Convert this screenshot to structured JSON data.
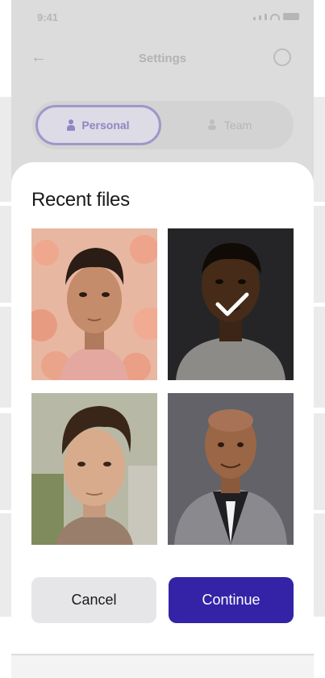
{
  "background_screen": {
    "status_time": "9:41",
    "title": "Settings",
    "back_icon": "arrow-left-icon",
    "help_icon": "help-circle-icon",
    "segments": [
      {
        "label": "Personal",
        "icon": "person-icon",
        "selected": true
      },
      {
        "label": "Team",
        "icon": "team-icon",
        "selected": false
      }
    ]
  },
  "modal": {
    "title": "Recent files",
    "files": [
      {
        "name": "photo-young-man-floral",
        "selected": false
      },
      {
        "name": "photo-man-dark-background",
        "selected": true
      },
      {
        "name": "photo-man-outdoor",
        "selected": false
      },
      {
        "name": "photo-man-in-suit",
        "selected": false
      }
    ],
    "cancel_label": "Cancel",
    "continue_label": "Continue"
  },
  "colors": {
    "accent": "#3422a7",
    "cancel_bg": "#e6e6e8",
    "overlay": "#dcdcdc"
  }
}
